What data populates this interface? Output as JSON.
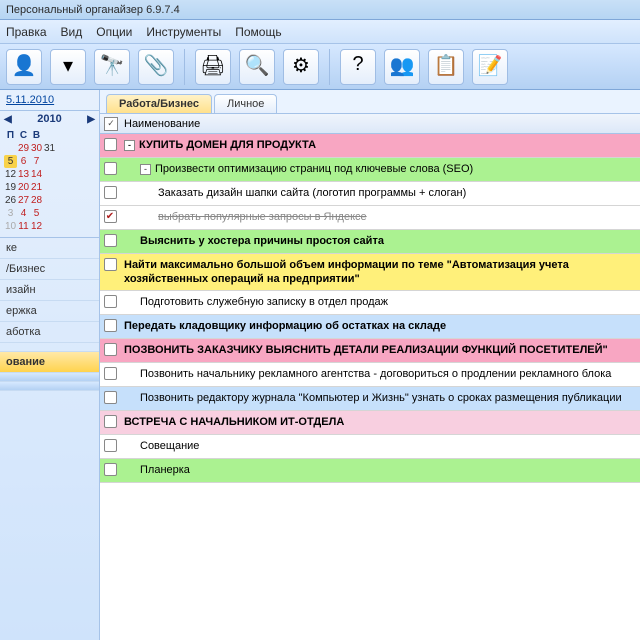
{
  "window_title": "Персональный органайзер 6.9.7.4",
  "menu": {
    "pravka": "Правка",
    "vid": "Вид",
    "optsii": "Опции",
    "instr": "Инструменты",
    "pomosh": "Помощь"
  },
  "toolbar_icons": [
    "person",
    "funnel",
    "binoculars",
    "attach",
    "printer",
    "preview",
    "gear",
    "help",
    "group",
    "paste",
    "note"
  ],
  "sidebar": {
    "date_link": "5.11.2010",
    "cal_month": "2010",
    "dow": [
      "П",
      "С",
      "В"
    ],
    "rows": [
      [
        "",
        "29",
        "30",
        "31"
      ],
      [
        "5",
        "6",
        "7"
      ],
      [
        "12",
        "13",
        "14"
      ],
      [
        "19",
        "20",
        "21"
      ],
      [
        "26",
        "27",
        "28"
      ],
      [
        "3",
        "4",
        "5"
      ],
      [
        "10",
        "11",
        "12"
      ]
    ],
    "today_idx": [
      1,
      0
    ],
    "items": [
      {
        "label": "ке",
        "cls": ""
      },
      {
        "label": "/Бизнес",
        "cls": ""
      },
      {
        "label": "изайн",
        "cls": ""
      },
      {
        "label": "ержка",
        "cls": ""
      },
      {
        "label": "аботка",
        "cls": ""
      },
      {
        "label": "",
        "cls": ""
      },
      {
        "label": "ование",
        "cls": "active"
      },
      {
        "label": "",
        "cls": "blue"
      },
      {
        "label": "",
        "cls": "blue"
      }
    ]
  },
  "tabs": [
    {
      "label": "Работа/Бизнес",
      "active": true
    },
    {
      "label": "Личное",
      "active": false
    }
  ],
  "list_header": "Наименование",
  "tasks": [
    {
      "bg": "bg-pink",
      "bold": true,
      "indent": 0,
      "exp": "-",
      "checked": false,
      "text": "КУПИТЬ ДОМЕН ДЛЯ ПРОДУКТА"
    },
    {
      "bg": "bg-green",
      "bold": false,
      "indent": 1,
      "exp": "-",
      "checked": false,
      "text": "Произвести оптимизацию страниц под ключевые слова (SEO)"
    },
    {
      "bg": "bg-white",
      "bold": false,
      "indent": 2,
      "exp": "",
      "checked": false,
      "text": "Заказать дизайн шапки сайта (логотип программы + слоган)"
    },
    {
      "bg": "bg-white",
      "bold": false,
      "indent": 2,
      "exp": "",
      "checked": true,
      "strike": true,
      "text": "выбрать популярные запросы в Яндексе"
    },
    {
      "bg": "bg-green",
      "bold": true,
      "indent": 1,
      "exp": "",
      "checked": false,
      "text": "Выяснить у хостера причины простоя сайта"
    },
    {
      "bg": "bg-yellow",
      "bold": true,
      "indent": 0,
      "exp": "",
      "checked": false,
      "text": "Найти максимально большой объем информации по теме \"Автоматизация учета хозяйственных операций на предприятии\""
    },
    {
      "bg": "bg-white",
      "bold": false,
      "indent": 1,
      "exp": "",
      "checked": false,
      "text": "Подготовить служебную записку в отдел продаж"
    },
    {
      "bg": "bg-blue",
      "bold": true,
      "indent": 0,
      "exp": "",
      "checked": false,
      "text": "Передать кладовщику информацию об остатках на складе"
    },
    {
      "bg": "bg-pink",
      "bold": true,
      "indent": 0,
      "exp": "",
      "checked": false,
      "text": "ПОЗВОНИТЬ ЗАКАЗЧИКУ ВЫЯСНИТЬ ДЕТАЛИ РЕАЛИЗАЦИИ ФУНКЦИЙ ПОСЕТИТЕЛЕЙ\""
    },
    {
      "bg": "bg-white",
      "bold": false,
      "indent": 1,
      "exp": "",
      "checked": false,
      "text": "Позвонить начальнику рекламного агентства - договориться о продлении рекламного блока"
    },
    {
      "bg": "bg-blue",
      "bold": false,
      "indent": 1,
      "exp": "",
      "checked": false,
      "text": "Позвонить редактору журнала \"Компьютер и Жизнь\" узнать о сроках размещения публикации"
    },
    {
      "bg": "bg-lpink",
      "bold": true,
      "indent": 0,
      "exp": "",
      "checked": false,
      "text": "ВСТРЕЧА С НАЧАЛЬНИКОМ ИТ-ОТДЕЛА"
    },
    {
      "bg": "bg-white",
      "bold": false,
      "indent": 1,
      "exp": "",
      "checked": false,
      "text": "Совещание"
    },
    {
      "bg": "bg-green",
      "bold": false,
      "indent": 1,
      "exp": "",
      "checked": false,
      "text": "Планерка"
    }
  ],
  "icon_svg": {
    "person": "👤",
    "funnel": "▾",
    "binoculars": "🔭",
    "attach": "📎",
    "printer": "🖨",
    "preview": "🔍",
    "gear": "⚙",
    "help": "?",
    "group": "👥",
    "paste": "📋",
    "note": "📝"
  }
}
